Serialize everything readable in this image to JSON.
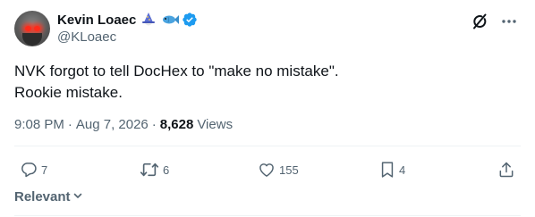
{
  "author": {
    "display_name": "Kevin Loaec",
    "name_emojis": [
      "wizard-icon",
      "fish-icon"
    ],
    "handle": "@KLoaec",
    "verified": true
  },
  "top_actions": [
    "grok-icon",
    "more-icon"
  ],
  "tweet": {
    "lines": [
      "NVK forgot to tell DocHex to \"make no mistake\".",
      "Rookie mistake."
    ]
  },
  "meta": {
    "time": "9:08 PM",
    "separator": "·",
    "date": "Aug 7, 2026",
    "views_count": "8,628",
    "views_label": "Views"
  },
  "actions": {
    "reply_count": "7",
    "retweet_count": "6",
    "like_count": "155",
    "bookmark_count": "4"
  },
  "sort": {
    "label": "Relevant"
  },
  "colors": {
    "text": "#0f1419",
    "secondary": "#536471",
    "verified": "#1d9bf0",
    "divider": "#eff3f4"
  }
}
